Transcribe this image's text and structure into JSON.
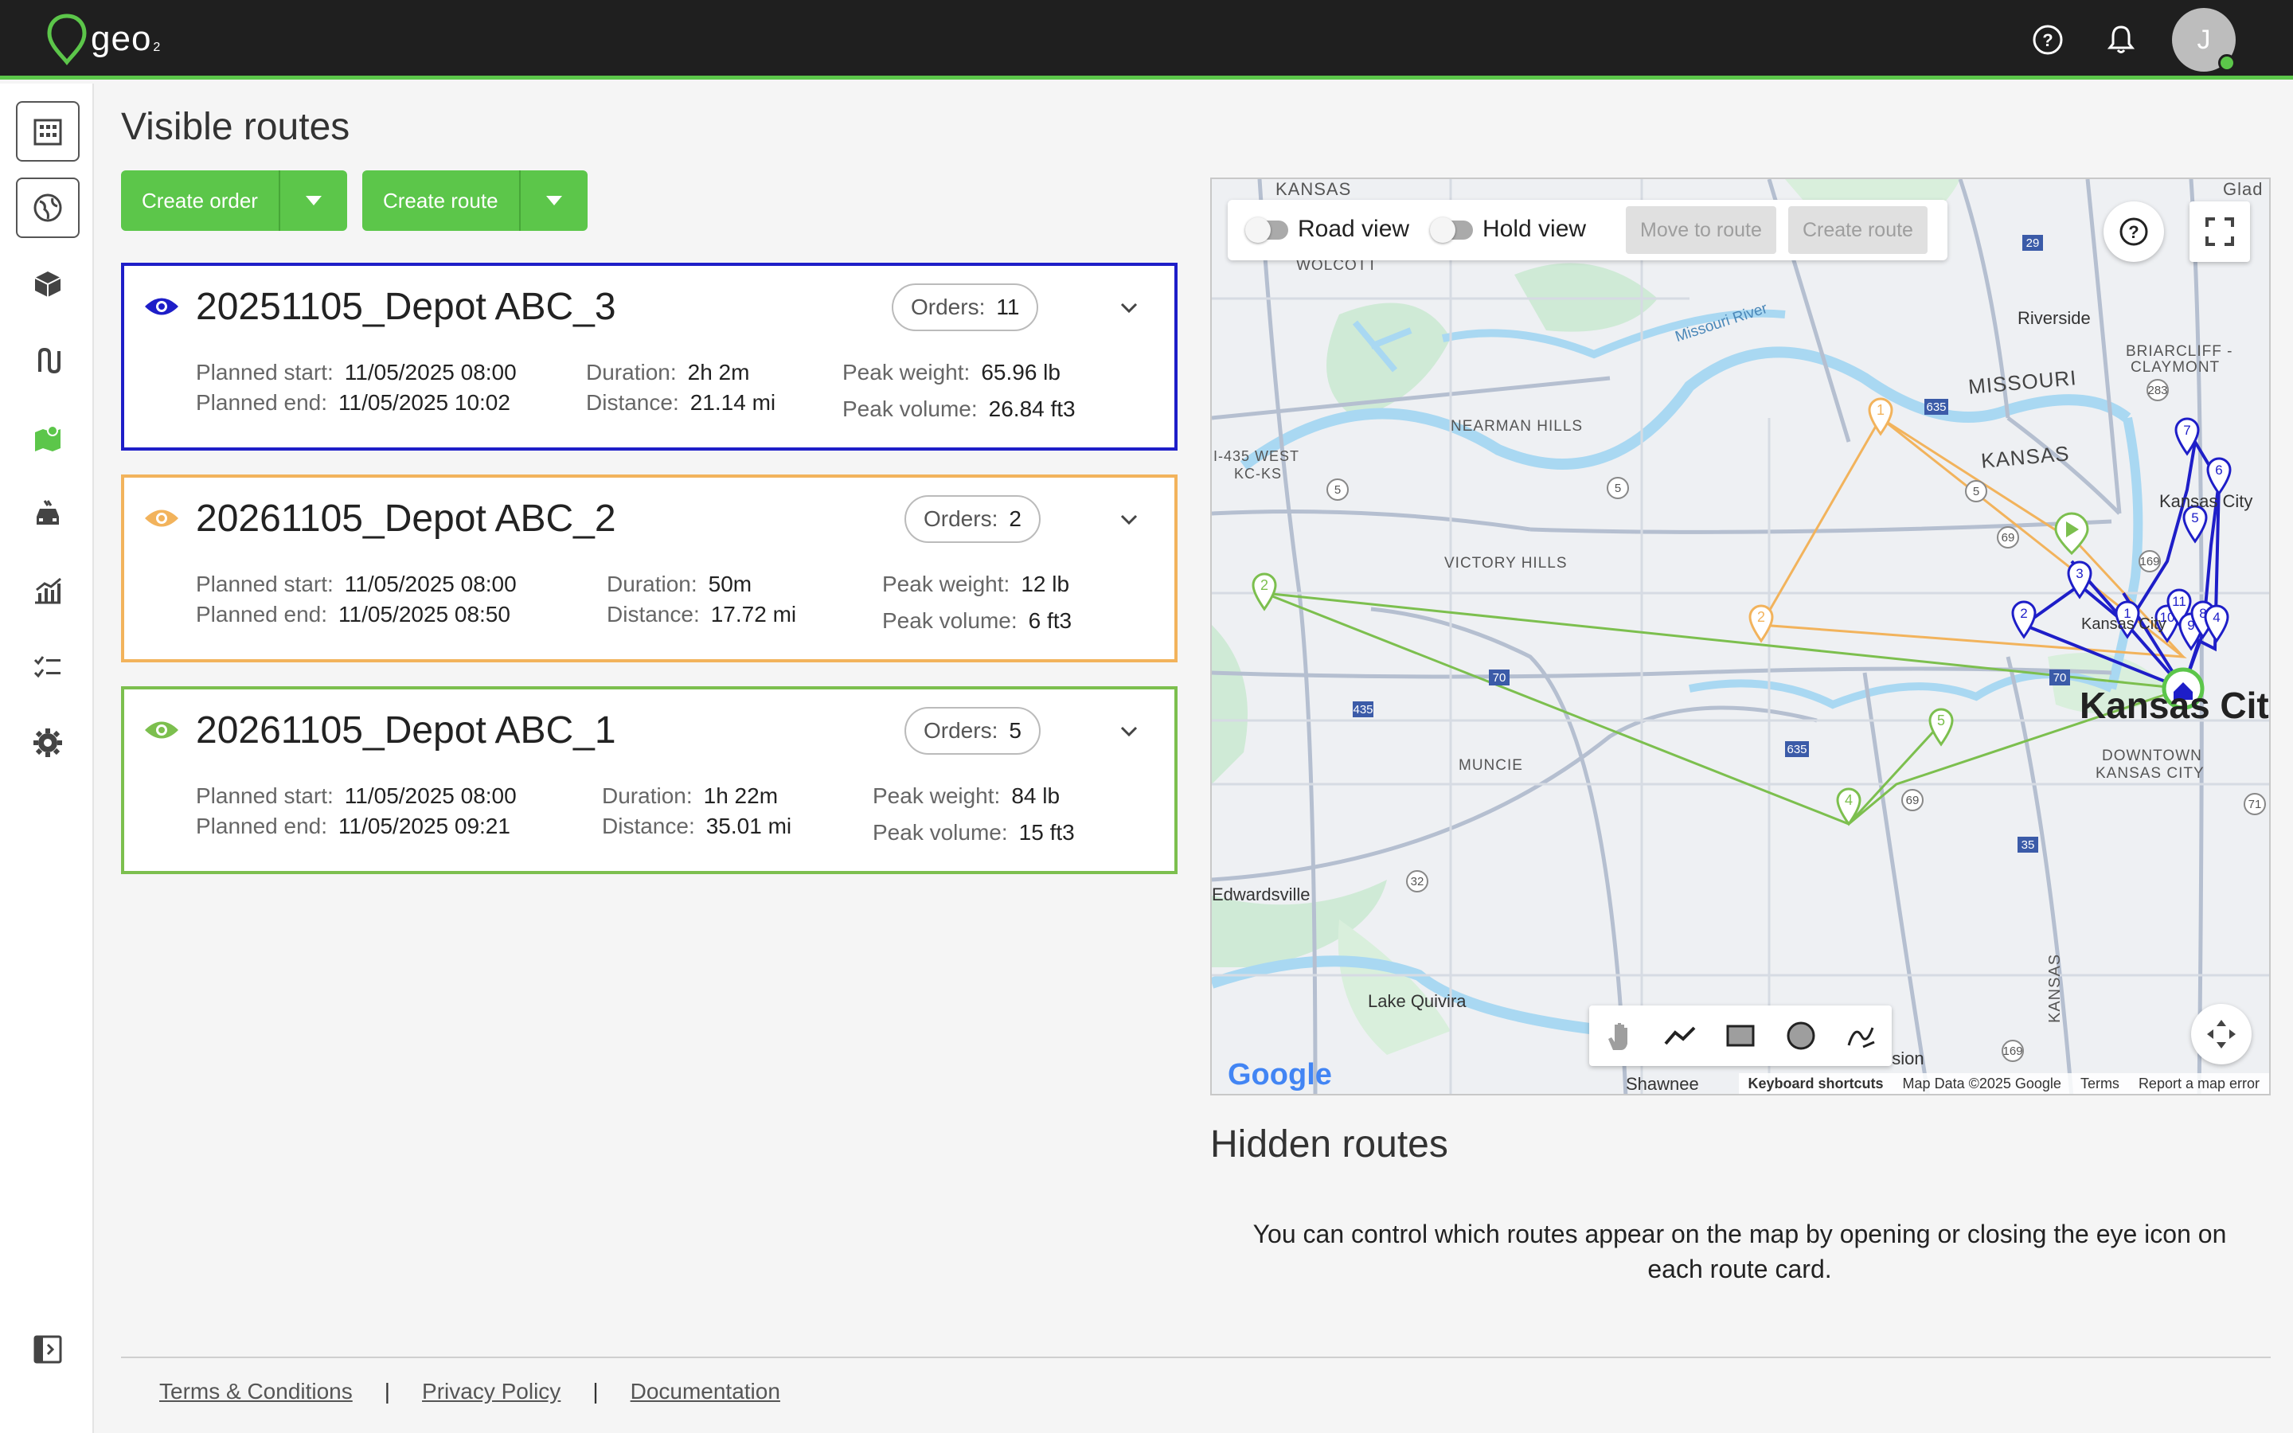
{
  "app": {
    "logo_text": "geo",
    "logo_sub": "2",
    "user_initial": "J"
  },
  "page": {
    "title": "Visible routes"
  },
  "actions": {
    "create_order": "Create order",
    "create_route": "Create route"
  },
  "routes": [
    {
      "name": "20251105_Depot ABC_3",
      "color": "#1e1ec8",
      "orders_label": "Orders:",
      "orders": "11",
      "planned_start_label": "Planned start:",
      "planned_start": "11/05/2025 08:00",
      "planned_end_label": "Planned end:",
      "planned_end": "11/05/2025 10:02",
      "duration_label": "Duration:",
      "duration": "2h 2m",
      "distance_label": "Distance:",
      "distance": "21.14 mi",
      "peak_weight_label": "Peak weight:",
      "peak_weight": "65.96 lb",
      "peak_volume_label": "Peak volume:",
      "peak_volume": "26.84 ft3"
    },
    {
      "name": "20261105_Depot ABC_2",
      "color": "#f2b35c",
      "orders_label": "Orders:",
      "orders": "2",
      "planned_start_label": "Planned start:",
      "planned_start": "11/05/2025 08:00",
      "planned_end_label": "Planned end:",
      "planned_end": "11/05/2025 08:50",
      "duration_label": "Duration:",
      "duration": "50m",
      "distance_label": "Distance:",
      "distance": "17.72 mi",
      "peak_weight_label": "Peak weight:",
      "peak_weight": "12 lb",
      "peak_volume_label": "Peak volume:",
      "peak_volume": "6 ft3"
    },
    {
      "name": "20261105_Depot ABC_1",
      "color": "#7cbf4e",
      "orders_label": "Orders:",
      "orders": "5",
      "planned_start_label": "Planned start:",
      "planned_start": "11/05/2025 08:00",
      "planned_end_label": "Planned end:",
      "planned_end": "11/05/2025 09:21",
      "duration_label": "Duration:",
      "duration": "1h 22m",
      "distance_label": "Distance:",
      "distance": "35.01 mi",
      "peak_weight_label": "Peak weight:",
      "peak_weight": "84 lb",
      "peak_volume_label": "Peak volume:",
      "peak_volume": "15 ft3"
    }
  ],
  "map": {
    "road_view": "Road view",
    "hold_view": "Hold view",
    "move_to_route": "Move to route",
    "create_route": "Create route",
    "google": "Google",
    "attribution": {
      "shawnee": "Shawnee",
      "keyboard": "Keyboard shortcuts",
      "data": "Map Data ©2025 Google",
      "terms": "Terms",
      "report": "Report a map error"
    },
    "labels": {
      "kansas_top": "KANSAS",
      "wolcott": "WOLCOTT",
      "glad": "Glad",
      "riverside": "Riverside",
      "briarcliff": "BRIARCLIFF -",
      "claymont": "CLAYMONT",
      "missouri_river": "Missouri River",
      "missouri": "MISSOURI",
      "kansas": "KANSAS",
      "nearman": "NEARMAN HILLS",
      "i435": "I-435 WEST",
      "kcks": "KC-KS",
      "victory": "VICTORY HILLS",
      "kansas_city": "Kansas City",
      "kan_city_big": "Kansas City",
      "downtown": "DOWNTOWN",
      "downtown2": "KANSAS CITY",
      "muncie": "MUNCIE",
      "edwardsville": "Edwardsville",
      "lake_quivira": "Lake Quivira",
      "mission": "Mission",
      "kansas_vert": "KANSAS"
    }
  },
  "hidden": {
    "title": "Hidden routes",
    "text": "You can control which routes appear on the map by opening or closing the eye icon on each route card."
  },
  "footer": {
    "terms": "Terms & Conditions",
    "privacy": "Privacy Policy",
    "docs": "Documentation",
    "sep": "|"
  },
  "colors": {
    "accent": "#5cc64a",
    "route3": "#1e1ec8",
    "route2": "#f2b35c",
    "route1": "#7cbf4e"
  }
}
